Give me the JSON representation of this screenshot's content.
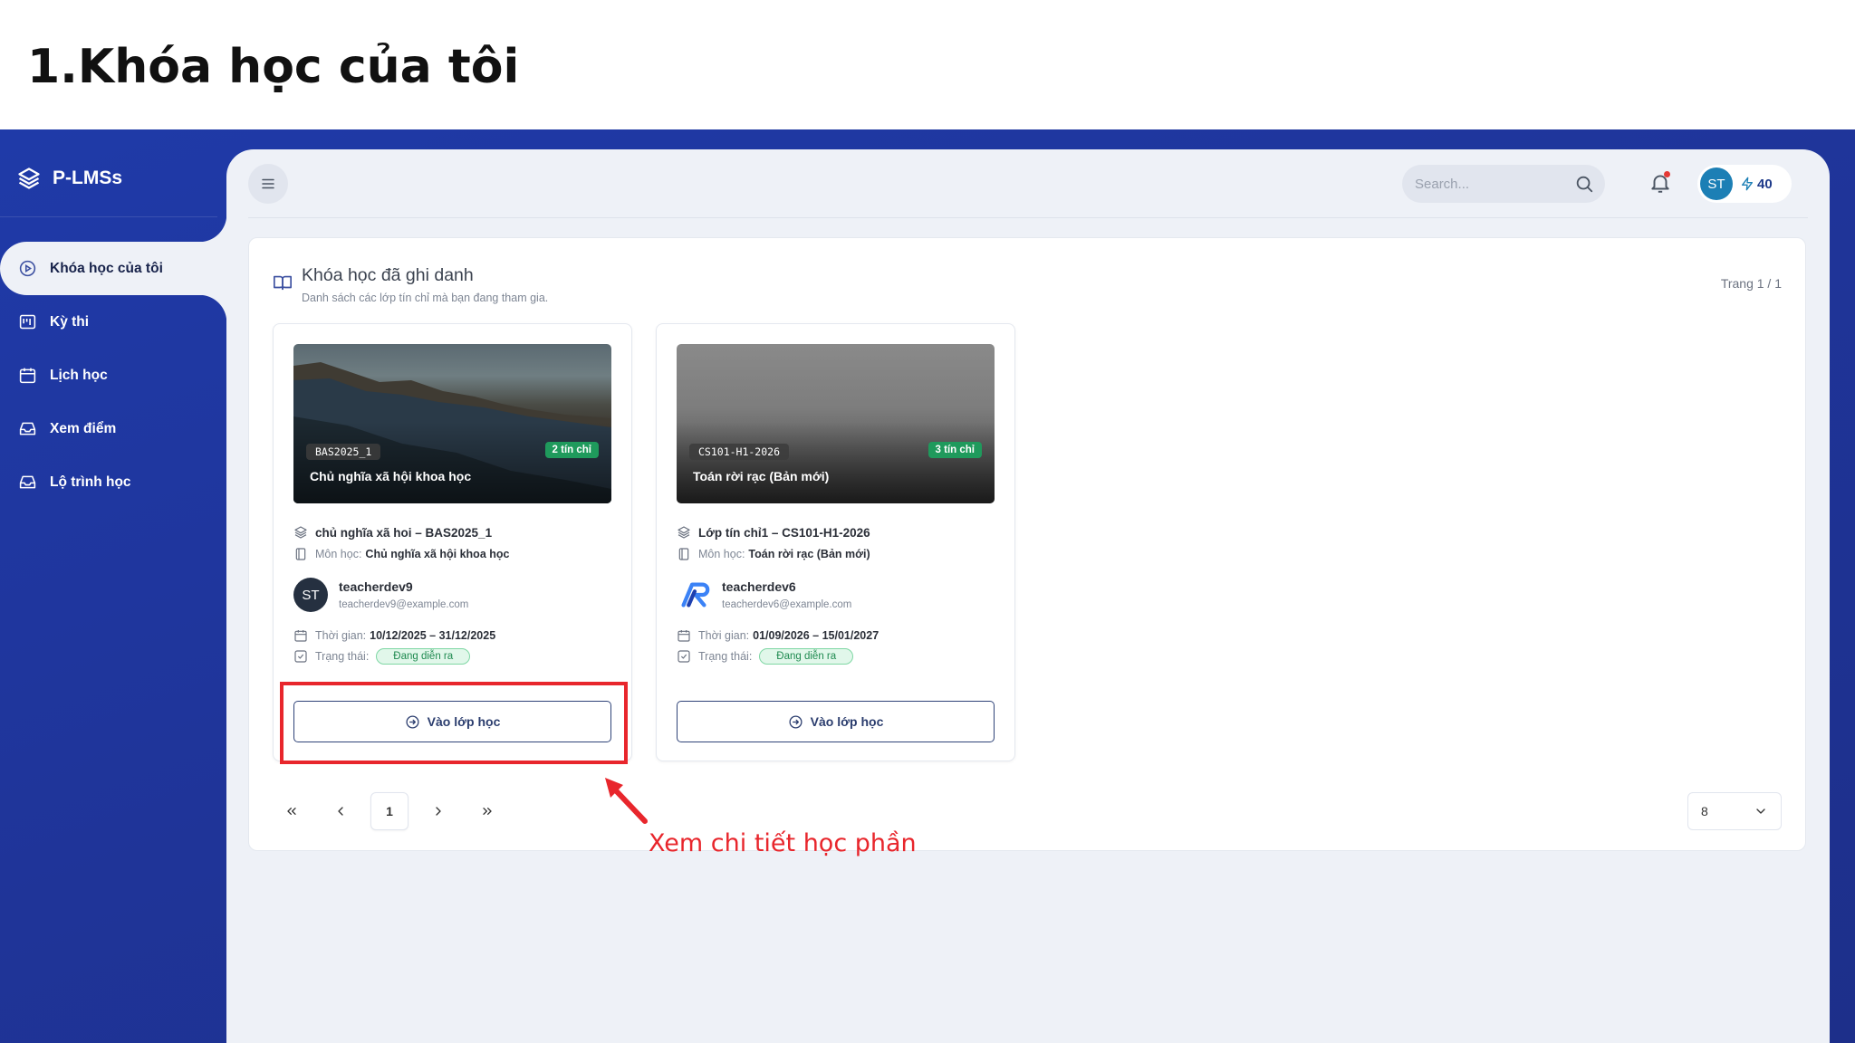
{
  "slide_title": "1.Khóa học của tôi",
  "app": {
    "name": "P-LMSs"
  },
  "sidebar": {
    "items": [
      {
        "label": "Khóa học của tôi",
        "icon": "play-circle-icon",
        "active": true
      },
      {
        "label": "Kỳ thi",
        "icon": "exam-board-icon",
        "active": false
      },
      {
        "label": "Lịch học",
        "icon": "calendar-icon",
        "active": false
      },
      {
        "label": "Xem điểm",
        "icon": "inbox-icon",
        "active": false
      },
      {
        "label": "Lộ trình học",
        "icon": "inbox-icon",
        "active": false
      }
    ]
  },
  "topbar": {
    "search_placeholder": "Search...",
    "user_initials": "ST",
    "points": "40",
    "notification_dot": true
  },
  "content": {
    "title": "Khóa học đã ghi danh",
    "subtitle": "Danh sách các lớp tín chỉ mà bạn đang tham gia.",
    "page_indicator": "Trang 1 / 1"
  },
  "courses": [
    {
      "code": "BAS2025_1",
      "credits": "2 tín chỉ",
      "image_title": "Chủ nghĩa xã hội khoa học",
      "class_name": "chủ nghĩa xã hoi – BAS2025_1",
      "subject_label": "Môn học:",
      "subject": "Chủ nghĩa xã hội khoa học",
      "teacher_initials": "ST",
      "teacher_name": "teacherdev9",
      "teacher_email": "teacherdev9@example.com",
      "time_label": "Thời gian:",
      "time": "10/12/2025 – 31/12/2025",
      "status_label": "Trạng thái:",
      "status": "Đang diễn ra",
      "button": "Vào lớp học"
    },
    {
      "code": "CS101-H1-2026",
      "credits": "3 tín chỉ",
      "image_title": "Toán rời rạc (Bản mới)",
      "class_name": "Lớp tín chỉ1 – CS101-H1-2026",
      "subject_label": "Môn học:",
      "subject": "Toán rời rạc (Bản mới)",
      "teacher_initials": "",
      "teacher_name": "teacherdev6",
      "teacher_email": "teacherdev6@example.com",
      "time_label": "Thời gian:",
      "time": "01/09/2026 – 15/01/2027",
      "status_label": "Trạng thái:",
      "status": "Đang diễn ra",
      "button": "Vào lớp học"
    }
  ],
  "pagination": {
    "current_page": "1",
    "page_size": "8"
  },
  "annotation": {
    "text": "Xem chi tiết học phần",
    "color": "#e8262c"
  },
  "colors": {
    "sidebar_bg": "#1f3aa8",
    "main_bg": "#eef1f7",
    "status_green": "#1f8a50",
    "credit_green": "#1f9a5c"
  }
}
